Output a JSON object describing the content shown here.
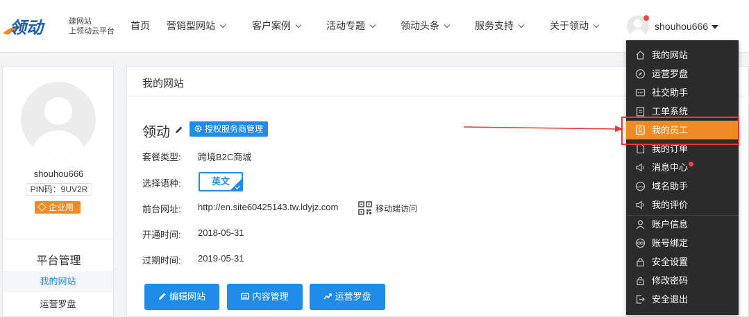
{
  "header": {
    "logo_sub_line1": "建网站",
    "logo_sub_line2": "上领动云平台",
    "nav": [
      {
        "label": "首页",
        "dropdown": false
      },
      {
        "label": "营销型网站",
        "dropdown": true
      },
      {
        "label": "客户案例",
        "dropdown": true
      },
      {
        "label": "活动专题",
        "dropdown": true
      },
      {
        "label": "领动头条",
        "dropdown": true
      },
      {
        "label": "服务支持",
        "dropdown": true
      },
      {
        "label": "关于领动",
        "dropdown": true
      }
    ],
    "user": {
      "name": "shouhou666",
      "has_notification": true
    }
  },
  "sidebar": {
    "username": "shouhou666",
    "pin": "PIN码：9UV2R",
    "badge": "企业用",
    "section_title": "平台管理",
    "items": [
      {
        "label": "我的网站",
        "active": true
      },
      {
        "label": "运营罗盘",
        "active": false
      }
    ]
  },
  "main": {
    "title": "我的网站",
    "site_name": "领动",
    "auth_button": "授权服务商管理",
    "rows": {
      "package_label": "套餐类型:",
      "package_value": "跨境B2C商城",
      "language_label": "选择语种:",
      "language_value": "英文",
      "url_label": "前台网址:",
      "url_value": "http://en.site60425143.tw.ldyjz.com",
      "mobile_link": "移动端访问",
      "open_label": "开通时间:",
      "open_value": "2018-05-31",
      "expire_label": "过期时间:",
      "expire_value": "2019-05-31"
    },
    "buttons": {
      "edit": "编辑网站",
      "content": "内容管理",
      "compass": "运营罗盘"
    }
  },
  "dropdown": {
    "items": [
      {
        "label": "我的网站",
        "icon": "home-icon"
      },
      {
        "label": "运营罗盘",
        "icon": "compass-icon"
      },
      {
        "label": "社交助手",
        "icon": "chat-icon"
      },
      {
        "label": "工单系统",
        "icon": "clipboard-icon"
      },
      {
        "label": "我的员工",
        "icon": "staff-icon",
        "active": true
      },
      {
        "label": "我的订单",
        "icon": "order-icon"
      },
      {
        "label": "消息中心",
        "icon": "speaker-icon",
        "dot": true
      },
      {
        "label": "域名助手",
        "icon": "www-icon"
      },
      {
        "label": "我的评价",
        "icon": "speaker-icon"
      },
      {
        "label": "账户信息",
        "icon": "user-icon"
      },
      {
        "label": "账号绑定",
        "icon": "link-icon"
      },
      {
        "label": "安全设置",
        "icon": "lock-icon"
      },
      {
        "label": "修改密码",
        "icon": "key-icon"
      },
      {
        "label": "安全退出",
        "icon": "logout-icon"
      }
    ]
  },
  "colors": {
    "accent_blue": "#1e8ce8",
    "accent_orange": "#f08a24",
    "dropdown_bg": "#2b2b2b",
    "annotation_red": "#e53935"
  }
}
